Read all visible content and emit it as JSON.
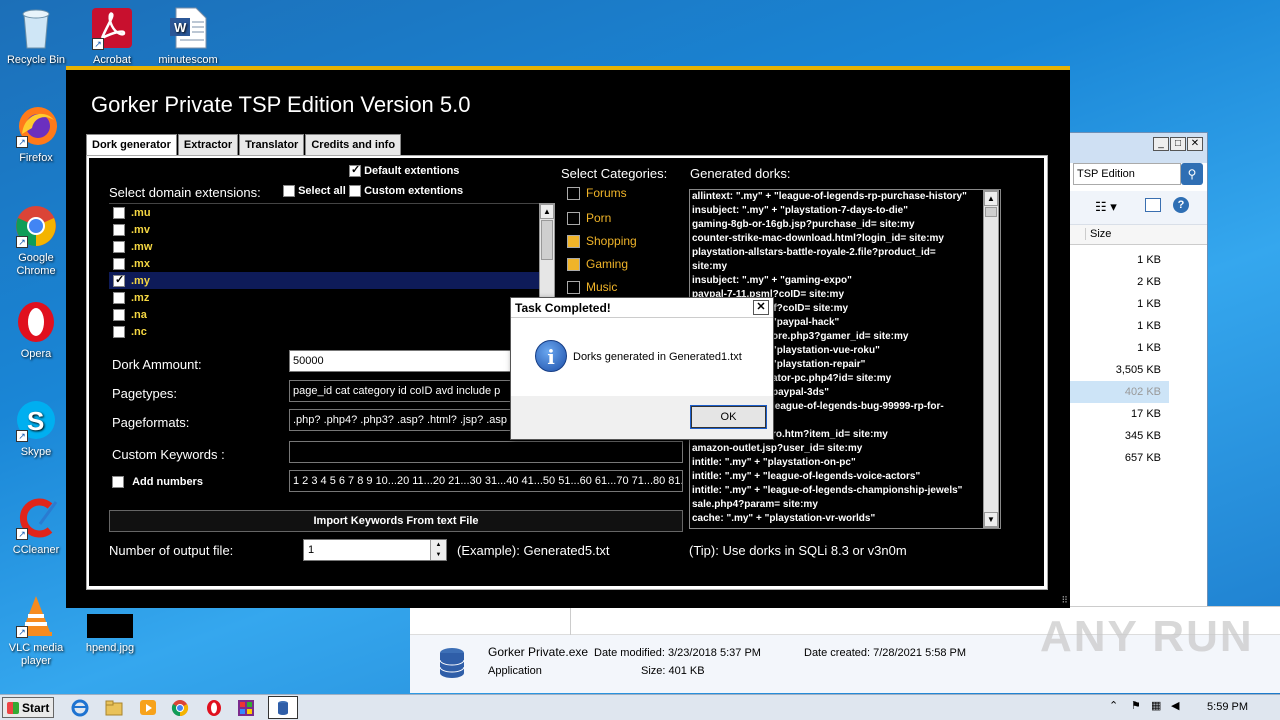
{
  "desktop": {
    "icons": [
      {
        "label": "Recycle Bin"
      },
      {
        "label": "Acrobat"
      },
      {
        "label": "minutescom"
      },
      {
        "label": "Firefox"
      },
      {
        "label": "Google Chrome"
      },
      {
        "label": "Opera"
      },
      {
        "label": "Skype"
      },
      {
        "label": "CCleaner"
      },
      {
        "label": "VLC media player"
      },
      {
        "label": "hpend.jpg"
      }
    ]
  },
  "explorer": {
    "search_text": "TSP Edition",
    "size_header": "Size",
    "sizes": [
      "1 KB",
      "2 KB",
      "1 KB",
      "1 KB",
      "1 KB",
      "3,505 KB",
      "402 KB",
      "17 KB",
      "345 KB",
      "657 KB"
    ],
    "details": {
      "name": "Gorker Private.exe",
      "type": "Application",
      "date_modified": "Date modified: 3/23/2018 5:37 PM",
      "size": "Size: 401 KB",
      "date_created": "Date created: 7/28/2021 5:58 PM"
    }
  },
  "watermark": "ANY RUN",
  "app": {
    "title": "Gorker Private TSP Edition Version 5.0",
    "tabs": [
      "Dork generator",
      "Extractor",
      "Translator",
      "Credits and info"
    ],
    "select_domain_label": "Select domain extensions:",
    "select_all_label": "Select all",
    "default_ext_label": "Default extentions",
    "custom_ext_label": "Custom extentions",
    "extensions": [
      {
        "label": ".mu",
        "checked": false
      },
      {
        "label": ".mv",
        "checked": false
      },
      {
        "label": ".mw",
        "checked": false
      },
      {
        "label": ".mx",
        "checked": false
      },
      {
        "label": ".my",
        "checked": true
      },
      {
        "label": ".mz",
        "checked": false
      },
      {
        "label": ".na",
        "checked": false
      },
      {
        "label": ".nc",
        "checked": false
      }
    ],
    "dork_amount_label": "Dork Ammount:",
    "dork_amount_value": "50000",
    "pagetypes_label": "Pagetypes:",
    "pagetypes_value": "page_id cat category id coID avd include p",
    "pageformats_label": "Pageformats:",
    "pageformats_value": ".php? .php4? .php3? .asp? .html? .jsp? .asp",
    "custom_keywords_label": "Custom Keywords :",
    "custom_keywords_value": "",
    "add_numbers_label": "Add numbers",
    "numbers_value": "1 2 3 4 5 6 7 8 9 10...20 11...20 21...30 31...40 41...50 51...60 61...70 71...80 81...",
    "import_button": "Import Keywords From text File",
    "output_files_label": "Number of output file:",
    "output_files_value": "1",
    "example_label": "(Example): Generated5.txt",
    "select_categories_label": "Select Categories:",
    "categories": [
      {
        "label": "Forums",
        "checked": false
      },
      {
        "label": "Porn",
        "checked": false
      },
      {
        "label": "Shopping",
        "checked": true
      },
      {
        "label": "Gaming",
        "checked": true
      },
      {
        "label": "Music",
        "checked": false
      }
    ],
    "generated_label": "Generated dorks:",
    "dorks": [
      "allintext: \".my\" + \"league-of-legends-rp-purchase-history\"",
      "insubject: \".my\" + \"playstation-7-days-to-die\"",
      "gaming-8gb-or-16gb.jsp?purchase_id= site:my",
      "counter-strike-mac-download.html?login_id= site:my",
      "playstation-allstars-battle-royale-2.file?product_id=",
      "site:my",
      "insubject: \".my\" + \"gaming-expo\"",
      "paypal-7-11.psml?coID= site:my",
      "ls.pdf?coID= site:my",
      "\"paypal-hack\"",
      "ore.php3?gamer_id= site:my",
      "\"playstation-vue-roku\"",
      "\"playstation-repair\"",
      "ator-pc.php4?id= site:my",
      "paypal-3ds\"",
      "league-of-legends-bug-99999-rp-for-",
      "",
      "ro.htm?item_id= site:my",
      "amazon-outlet.jsp?user_id= site:my",
      "intitle: \".my\" + \"playstation-on-pc\"",
      "intitle: \".my\" + \"league-of-legends-voice-actors\"",
      "intitle: \".my\" + \"league-of-legends-championship-jewels\"",
      "sale.php4?param= site:my",
      "cache: \".my\" + \"playstation-vr-worlds\""
    ],
    "tip_label": "(Tip): Use dorks in SQLi 8.3 or v3n0m"
  },
  "dialog": {
    "title": "Task Completed!",
    "message": "Dorks generated in Generated1.txt",
    "ok_label": "OK",
    "close_label": "✕"
  },
  "taskbar": {
    "start_label": "Start",
    "clock": "5:59 PM"
  }
}
